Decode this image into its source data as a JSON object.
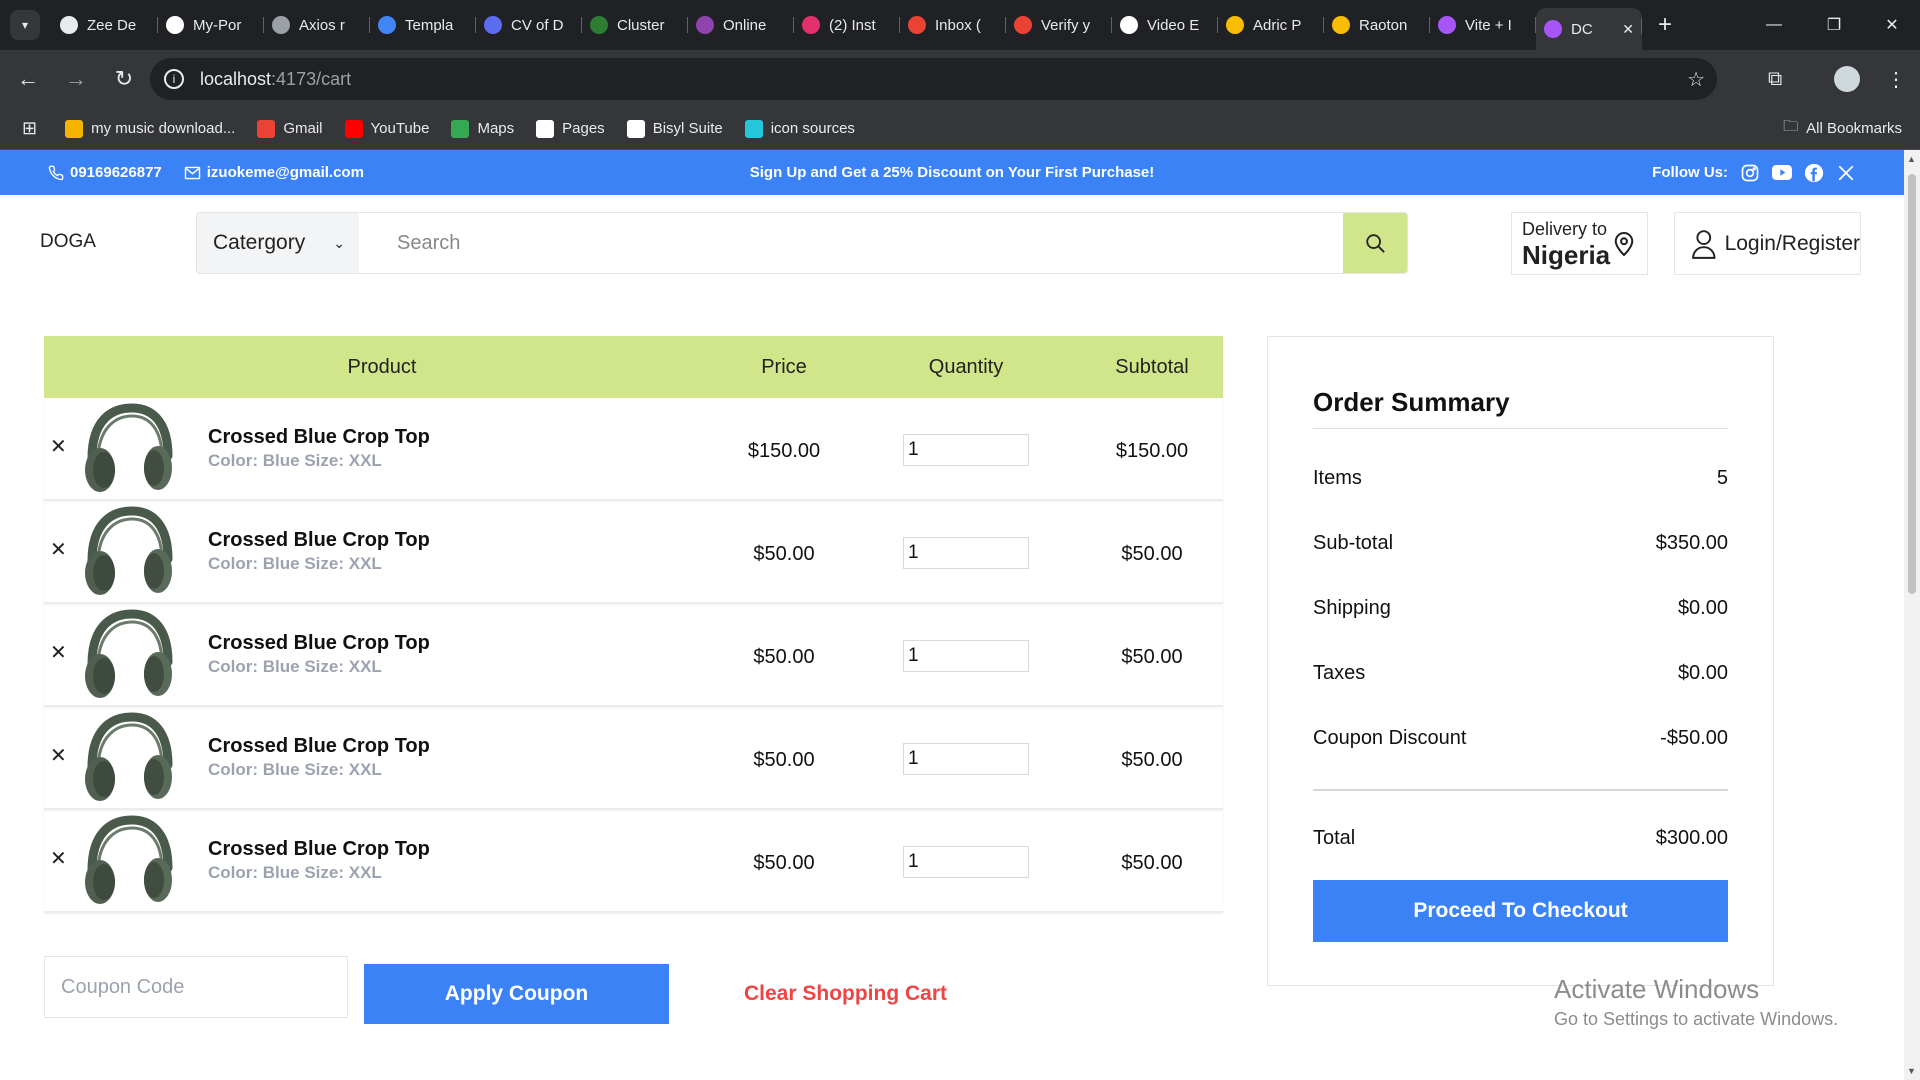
{
  "browser": {
    "tabs": [
      {
        "title": "Zee De",
        "color": "#e8eaed"
      },
      {
        "title": "My-Por",
        "color": "#ffffff"
      },
      {
        "title": "Axios r",
        "color": "#9aa0a6"
      },
      {
        "title": "Templa",
        "color": "#4285f4"
      },
      {
        "title": "CV of D",
        "color": "#5b6cf0"
      },
      {
        "title": "Cluster",
        "color": "#2e7d32"
      },
      {
        "title": "Online",
        "color": "#8e44ad"
      },
      {
        "title": "(2) Inst",
        "color": "#e1306c"
      },
      {
        "title": "Inbox (",
        "color": "#ea4335"
      },
      {
        "title": "Verify y",
        "color": "#ea4335"
      },
      {
        "title": "Video E",
        "color": "#ffffff"
      },
      {
        "title": "Adric P",
        "color": "#fbbc04"
      },
      {
        "title": "Raoton",
        "color": "#fbbc04"
      },
      {
        "title": "Vite + I",
        "color": "#a855f7"
      },
      {
        "title": "DC",
        "color": "#a855f7"
      }
    ],
    "url_host": "localhost",
    "url_path": ":4173/cart",
    "bookmarks": [
      {
        "label": "my music download...",
        "color": "#f4b400"
      },
      {
        "label": "Gmail",
        "color": "#ea4335"
      },
      {
        "label": "YouTube",
        "color": "#ff0000"
      },
      {
        "label": "Maps",
        "color": "#34a853"
      },
      {
        "label": "Pages",
        "color": "#ffffff"
      },
      {
        "label": "Bisyl Suite",
        "color": "#ffffff"
      },
      {
        "label": "icon sources",
        "color": "#26c6da"
      }
    ],
    "all_bookmarks": "All Bookmarks"
  },
  "topbar": {
    "phone": "09169626877",
    "email": "izuokeme@gmail.com",
    "promo": "Sign Up and Get a 25% Discount on Your First Purchase!",
    "follow": "Follow Us:"
  },
  "header": {
    "logo": "DOGA",
    "category": "Catergory",
    "search_placeholder": "Search",
    "delivery_label": "Delivery to",
    "delivery_country": "Nigeria",
    "login": "Login/Register"
  },
  "cart": {
    "headers": {
      "product": "Product",
      "price": "Price",
      "quantity": "Quantity",
      "subtotal": "Subtotal"
    },
    "items": [
      {
        "name": "Crossed Blue Crop Top",
        "variant": "Color: Blue Size: XXL",
        "price": "$150.00",
        "qty": "1",
        "subtotal": "$150.00"
      },
      {
        "name": "Crossed Blue Crop Top",
        "variant": "Color: Blue Size: XXL",
        "price": "$50.00",
        "qty": "1",
        "subtotal": "$50.00"
      },
      {
        "name": "Crossed Blue Crop Top",
        "variant": "Color: Blue Size: XXL",
        "price": "$50.00",
        "qty": "1",
        "subtotal": "$50.00"
      },
      {
        "name": "Crossed Blue Crop Top",
        "variant": "Color: Blue Size: XXL",
        "price": "$50.00",
        "qty": "1",
        "subtotal": "$50.00"
      },
      {
        "name": "Crossed Blue Crop Top",
        "variant": "Color: Blue Size: XXL",
        "price": "$50.00",
        "qty": "1",
        "subtotal": "$50.00"
      }
    ],
    "coupon_placeholder": "Coupon Code",
    "apply_label": "Apply Coupon",
    "clear_label": "Clear Shopping Cart"
  },
  "summary": {
    "title": "Order Summary",
    "items_label": "Items",
    "items_value": "5",
    "subtotal_label": "Sub-total",
    "subtotal_value": "$350.00",
    "shipping_label": "Shipping",
    "shipping_value": "$0.00",
    "taxes_label": "Taxes",
    "taxes_value": "$0.00",
    "coupon_label": "Coupon Discount",
    "coupon_value": "-$50.00",
    "total_label": "Total",
    "total_value": "$300.00",
    "checkout_label": "Proceed To Checkout"
  },
  "watermark": {
    "line1": "Activate Windows",
    "line2": "Go to Settings to activate Windows."
  },
  "colors": {
    "accent": "#3b82f6",
    "lime": "#d1e68a",
    "danger": "#ef4444"
  }
}
